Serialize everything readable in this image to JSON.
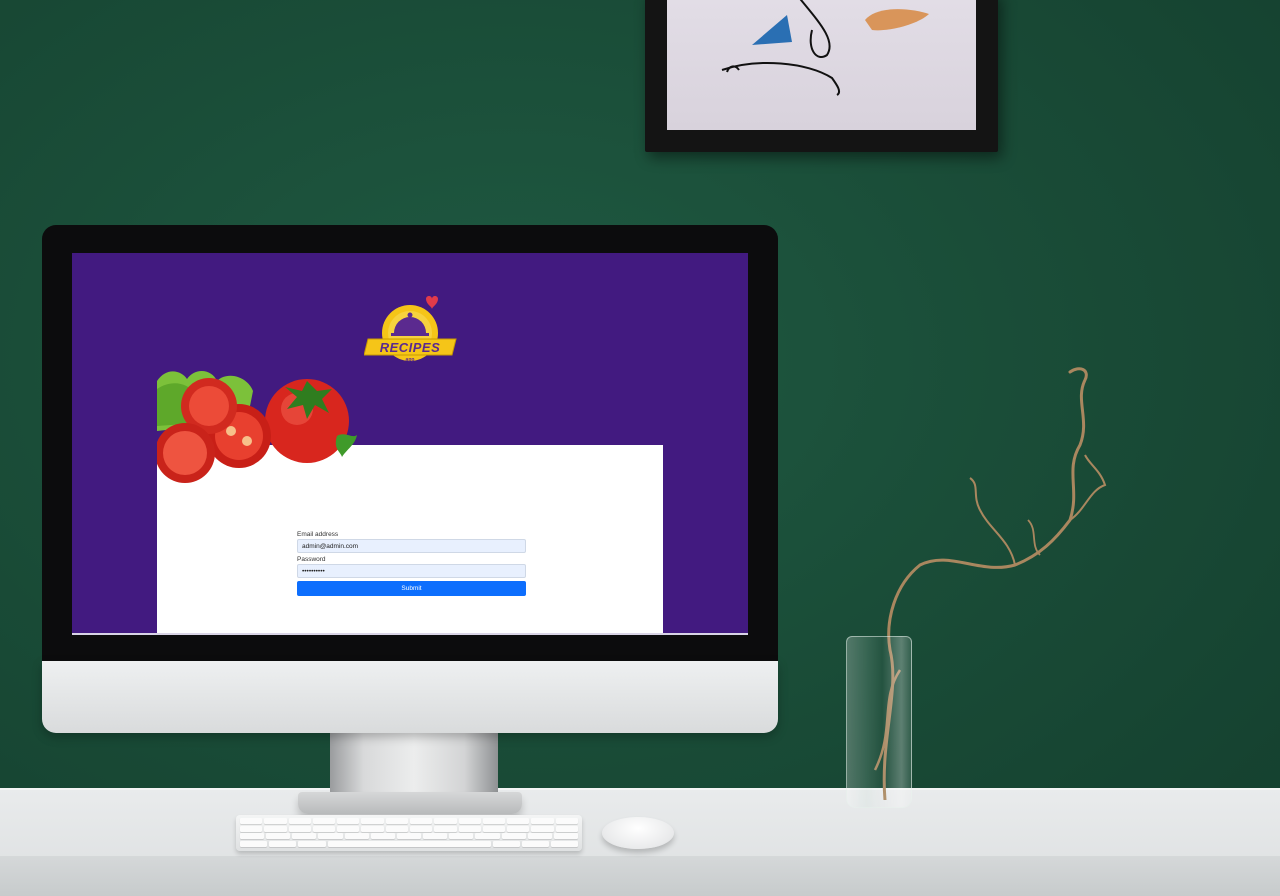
{
  "login_form": {
    "email_label": "Email address",
    "email_value": "admin@admin.com",
    "password_label": "Password",
    "password_value": "••••••••••",
    "submit_label": "Submit"
  },
  "logo": {
    "text": "RECIPES",
    "subtext": "app"
  },
  "colors": {
    "screen_background": "#421a80",
    "card_background": "#ffffff",
    "submit_button": "#0d6efd",
    "input_background": "#e8f0fe",
    "logo_yellow": "#f5c518",
    "wall": "#1a4d38"
  },
  "icons": {
    "logo_icon": "cloche-icon",
    "heart_icon": "heart-icon"
  }
}
